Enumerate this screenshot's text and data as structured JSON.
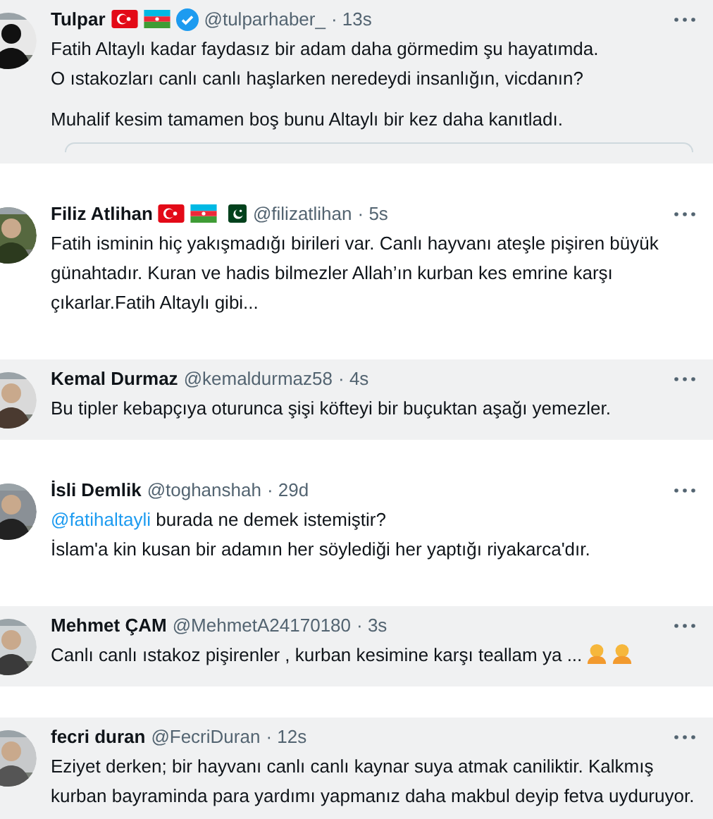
{
  "tweets": [
    {
      "name": "Tulpar",
      "badges": [
        {
          "kind": "turkey-flag"
        },
        {
          "kind": "azerbaijan-flag"
        },
        {
          "kind": "verified"
        }
      ],
      "handle": "@tulparhaber_",
      "time": "· 13s",
      "highlighted": true,
      "paragraphs": [
        {
          "text": "Fatih Altaylı kadar faydasız bir adam daha görmedim şu hayatımda.\nO ıstakozları canlı canlı haşlarken neredeydi insanlığın, vicdanın?"
        },
        {
          "text": "Muhalif kesim tamamen boş bunu Altaylı bir kez daha kanıtladı."
        }
      ],
      "quoted_card": true
    },
    {
      "name": "Filiz Atlihan",
      "badges": [
        {
          "kind": "turkey-flag"
        },
        {
          "kind": "azerbaijan-flag"
        },
        {
          "kind": "pakistan-flag"
        }
      ],
      "handle": "@filizatlihan",
      "time": "· 5s",
      "highlighted": false,
      "paragraphs": [
        {
          "text": "Fatih isminin hiç yakışmadığı birileri var. Canlı hayvanı ateşle pişiren büyük günahtadır. Kuran ve hadis bilmezler Allah’ın kurban kes emrine karşı çıkarlar.Fatih Altaylı gibi..."
        }
      ]
    },
    {
      "name": "Kemal Durmaz",
      "handle": "@kemaldurmaz58",
      "time": "· 4s",
      "highlighted": true,
      "paragraphs": [
        {
          "text": "Bu tipler kebapçıya oturunca şişi köfteyi bir buçuktan aşağı yemezler."
        }
      ]
    },
    {
      "name": "İsli Demlik",
      "handle": "@toghanshah",
      "time": "· 29d",
      "highlighted": false,
      "paragraphs": [
        {
          "mention": "@fatihaltayli",
          "text": " burada ne demek istemiştir?\nİslam'a kin kusan bir adamın her söylediği her yaptığı riyakarca'dır."
        }
      ]
    },
    {
      "name": "Mehmet ÇAM",
      "handle": "@MehmetA24170180",
      "time": "· 3s",
      "highlighted": true,
      "paragraphs": [
        {
          "text": "Canlı canlı ıstakoz pişirenler , kurban kesimine karşı teallam ya ...",
          "trailing_icons": [
            {
              "kind": "person-emoji"
            },
            {
              "kind": "person-emoji"
            }
          ]
        }
      ]
    },
    {
      "name": "fecri duran",
      "handle": "@FecriDuran",
      "time": "· 12s",
      "highlighted": true,
      "paragraphs": [
        {
          "text": "Eziyet derken; bir hayvanı canlı canlı kaynar suya atmak caniliktir. Kalkmış kurban bayraminda para yardımı yapmanız daha makbul deyip fetva uyduruyor."
        }
      ]
    }
  ]
}
